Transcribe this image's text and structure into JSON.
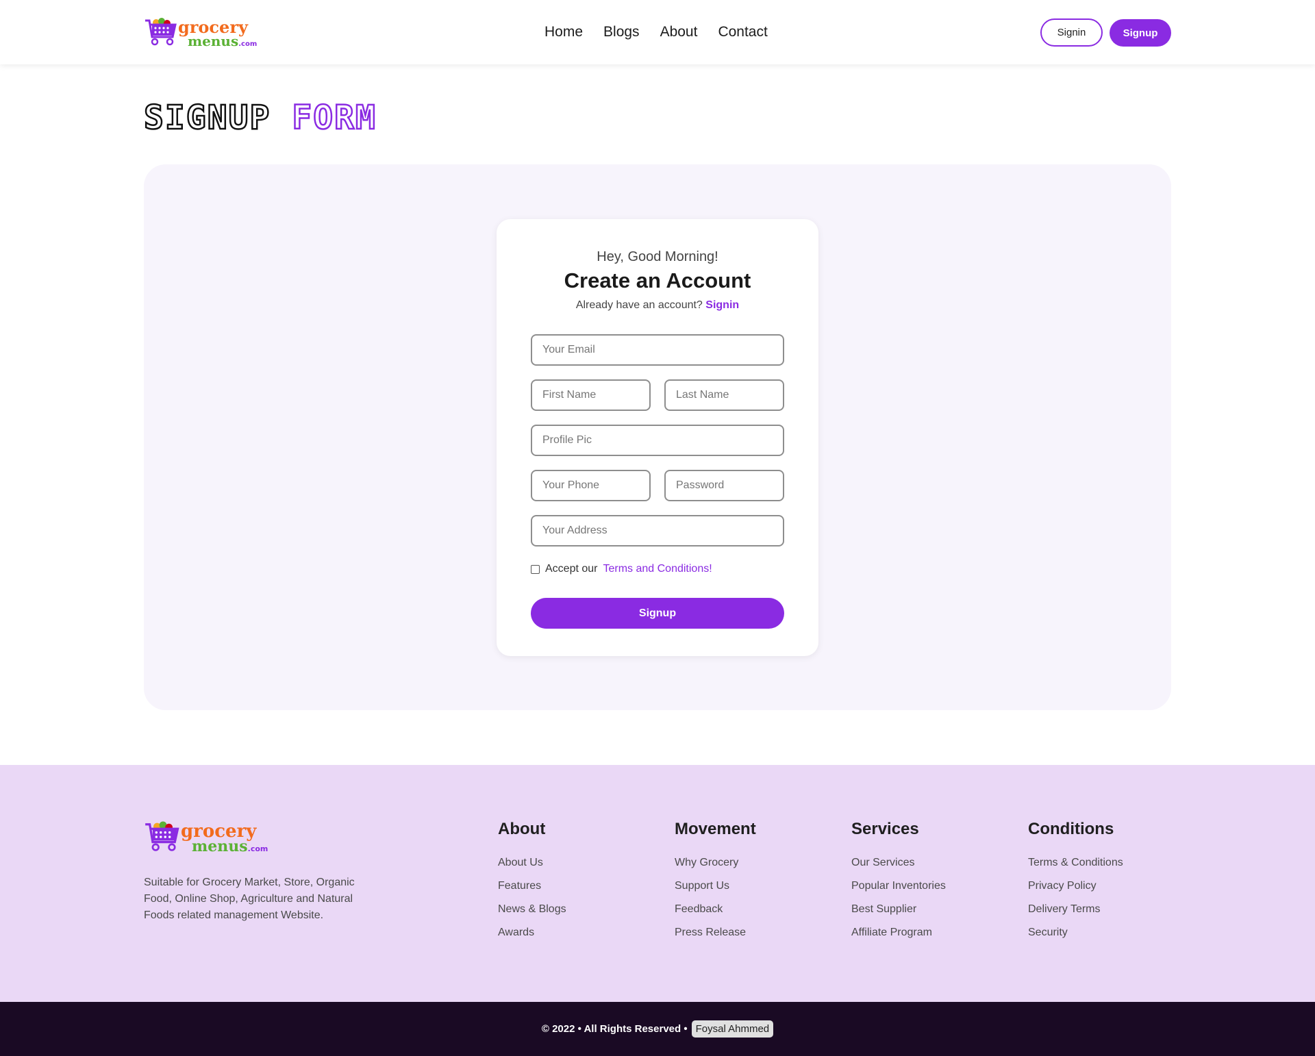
{
  "brand": {
    "name_top": "grocery",
    "name_bottom": "menus",
    "name_suffix": ".com",
    "colors": {
      "accent": "#8a2be2",
      "orange": "#f26b1d",
      "green": "#5bb135",
      "footer_bg": "#ead8f6",
      "bottom_bar_bg": "#1a0a24"
    }
  },
  "header": {
    "nav": [
      "Home",
      "Blogs",
      "About",
      "Contact"
    ],
    "signin_label": "Signin",
    "signup_label": "Signup"
  },
  "page": {
    "title_part1": "SIGNUP",
    "title_part2": "FORM"
  },
  "form": {
    "greeting": "Hey, Good Morning!",
    "title": "Create an Account",
    "have_account_text": "Already have an account?",
    "signin_link": "Signin",
    "email_placeholder": "Your Email",
    "first_name_placeholder": "First Name",
    "last_name_placeholder": "Last Name",
    "profile_pic_placeholder": "Profile Pic",
    "phone_placeholder": "Your Phone",
    "password_placeholder": "Password",
    "address_placeholder": "Your Address",
    "terms_prefix": "Accept our",
    "terms_link": "Terms and Conditions!",
    "terms_checked": false,
    "submit_label": "Signup"
  },
  "footer": {
    "description": "Suitable for Grocery Market, Store, Organic Food, Online Shop, Agriculture and Natural Foods related management Website.",
    "columns": [
      {
        "title": "About",
        "links": [
          "About Us",
          "Features",
          "News & Blogs",
          "Awards"
        ]
      },
      {
        "title": "Movement",
        "links": [
          "Why Grocery",
          "Support Us",
          "Feedback",
          "Press Release"
        ]
      },
      {
        "title": "Services",
        "links": [
          "Our Services",
          "Popular Inventories",
          "Best Supplier",
          "Affiliate Program"
        ]
      },
      {
        "title": "Conditions",
        "links": [
          "Terms & Conditions",
          "Privacy Policy",
          "Delivery Terms",
          "Security"
        ]
      }
    ],
    "copyright": "© 2022 • All Rights Reserved •",
    "author": "Foysal Ahmmed"
  }
}
